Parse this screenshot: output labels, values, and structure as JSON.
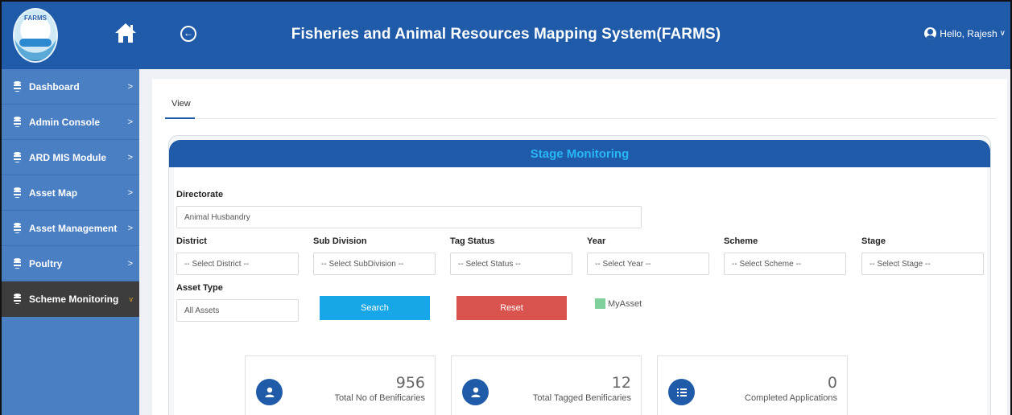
{
  "header": {
    "title": "Fisheries and Animal Resources Mapping System(FARMS)",
    "logo_text": "FARMS",
    "user_greeting": "Hello, Rajesh",
    "user_chevron": "∨",
    "collapse_glyph": "←",
    "home_icon": "home-icon",
    "brand_color": "#1f5ba8"
  },
  "sidebar": {
    "items": [
      {
        "label": "Dashboard",
        "arrow": ">"
      },
      {
        "label": "Admin Console",
        "arrow": ">"
      },
      {
        "label": "ARD MIS Module",
        "arrow": ">"
      },
      {
        "label": "Asset Map",
        "arrow": ">"
      },
      {
        "label": "Asset Management",
        "arrow": ">"
      },
      {
        "label": "Poultry",
        "arrow": ">"
      },
      {
        "label": "Scheme Monitoring",
        "arrow": "v",
        "active": true
      }
    ],
    "color": "#4a7fc4",
    "active_color": "#3d3d3d"
  },
  "tabs": [
    {
      "label": "View"
    }
  ],
  "panel": {
    "title": "Stage Monitoring",
    "title_color": "#29b6f6"
  },
  "form": {
    "directorate": {
      "label": "Directorate",
      "value": "Animal Husbandry"
    },
    "district": {
      "label": "District",
      "value": "-- Select District --"
    },
    "subdivision": {
      "label": "Sub Division",
      "value": "-- Select SubDivision --"
    },
    "tag_status": {
      "label": "Tag Status",
      "value": "-- Select Status --"
    },
    "year": {
      "label": "Year",
      "value": "-- Select Year --"
    },
    "scheme": {
      "label": "Scheme",
      "value": "-- Select Scheme --"
    },
    "stage": {
      "label": "Stage",
      "value": "-- Select Stage --"
    },
    "asset_type": {
      "label": "Asset Type",
      "value": "All Assets"
    },
    "search_label": "Search",
    "reset_label": "Reset",
    "legend_label": "MyAsset",
    "legend_color": "#7fd09a"
  },
  "stats": [
    {
      "value": "956",
      "caption": "Total No of Benificaries",
      "icon": "user-icon"
    },
    {
      "value": "12",
      "caption": "Total Tagged Benificaries",
      "icon": "user-icon"
    },
    {
      "value": "0",
      "caption": "Completed Applications",
      "icon": "checklist-icon"
    }
  ]
}
